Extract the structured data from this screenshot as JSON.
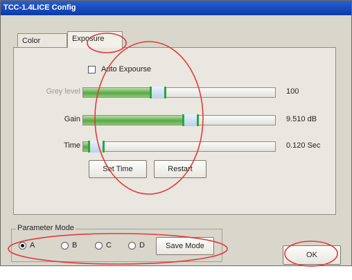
{
  "window": {
    "title": "TCC-1.4LICE Config"
  },
  "tabs": [
    {
      "label": "Color Adjust",
      "active": false
    },
    {
      "label": "Exposure",
      "active": true
    }
  ],
  "exposure": {
    "auto_label": "Auto Expourse",
    "auto_checked": false,
    "sliders": [
      {
        "label": "Grey level",
        "value": "100",
        "fill": 0.39,
        "enabled": false
      },
      {
        "label": "Gain",
        "value": "9.510 dB",
        "fill": 0.56,
        "enabled": true
      },
      {
        "label": "Time",
        "value": "0.120 Sec",
        "fill": 0.07,
        "enabled": true
      }
    ],
    "set_time_label": "Set Time",
    "restart_label": "Restart"
  },
  "param_mode": {
    "title": "Parameter Mode",
    "options": [
      {
        "label": "A",
        "selected": true
      },
      {
        "label": "B",
        "selected": false
      },
      {
        "label": "C",
        "selected": false
      },
      {
        "label": "D",
        "selected": false
      }
    ],
    "save_label": "Save Mode"
  },
  "ok_label": "OK",
  "colors": {
    "titlebar": "#0a3aa8",
    "slider_fill": "#5aa844",
    "thumb_border": "#28a838",
    "annotation": "#e03a3a"
  }
}
